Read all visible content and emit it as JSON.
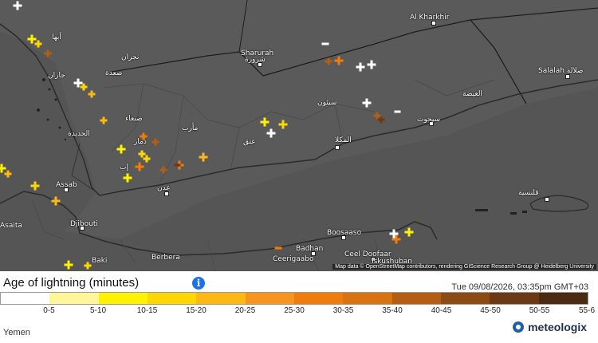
{
  "map": {
    "labels": [
      {
        "id": "al-khakhir",
        "text": "Al Kharkhir",
        "type": "en"
      },
      {
        "id": "sharurah-en",
        "text": "Sharurah",
        "type": "en"
      },
      {
        "id": "sharurah-ar",
        "text": "شرورة",
        "type": "ar"
      },
      {
        "id": "salalah",
        "text": "Salalah صلالة",
        "type": "en"
      },
      {
        "id": "abha",
        "text": "أبها",
        "type": "ar"
      },
      {
        "id": "najran",
        "text": "نجران",
        "type": "ar"
      },
      {
        "id": "jizan",
        "text": "جازان",
        "type": "ar"
      },
      {
        "id": "saada",
        "text": "صعدة",
        "type": "ar"
      },
      {
        "id": "sanaa",
        "text": "صنعاء",
        "type": "ar"
      },
      {
        "id": "marib",
        "text": "مأرب",
        "type": "ar"
      },
      {
        "id": "hudaydah",
        "text": "الحديدة",
        "type": "ar"
      },
      {
        "id": "dhamar",
        "text": "ذمار",
        "type": "ar"
      },
      {
        "id": "ibb",
        "text": "إب",
        "type": "ar"
      },
      {
        "id": "ataq",
        "text": "عتق",
        "type": "ar"
      },
      {
        "id": "aden",
        "text": "عدن",
        "type": "ar"
      },
      {
        "id": "seiyun",
        "text": "سيئون",
        "type": "ar"
      },
      {
        "id": "al-ghaydah",
        "text": "الغيضة",
        "type": "ar"
      },
      {
        "id": "sayhut",
        "text": "سيحوت",
        "type": "ar"
      },
      {
        "id": "mukalla",
        "text": "المكلا",
        "type": "ar"
      },
      {
        "id": "qishn",
        "text": "قلنسية",
        "type": "ar"
      },
      {
        "id": "assab",
        "text": "Assab",
        "type": "en"
      },
      {
        "id": "djibouti",
        "text": "Djibouti",
        "type": "en"
      },
      {
        "id": "asaita",
        "text": "Asaita",
        "type": "en"
      },
      {
        "id": "baki",
        "text": "Baki",
        "type": "en"
      },
      {
        "id": "berbera",
        "text": "Berbera",
        "type": "en"
      },
      {
        "id": "boosaaso",
        "text": "Boosaaso",
        "type": "en"
      },
      {
        "id": "badhan",
        "text": "Badhan",
        "type": "en"
      },
      {
        "id": "ceelgaabo",
        "text": "Ceerigaabo",
        "type": "en"
      },
      {
        "id": "ceel-doofaar",
        "text": "Ceel Doofaar",
        "type": "en"
      },
      {
        "id": "iskushuban",
        "text": "Iskushuban",
        "type": "en"
      }
    ],
    "attribution": "Map data © OpenStreetMap contributors, rendering GIScience Research Group @ Heidelberg University"
  },
  "legend": {
    "title": "Age of lightning (minutes)",
    "info_icon": "info-icon",
    "timestamp": "Tue 09/08/2026, 03:35pm GMT+03",
    "bins": [
      {
        "label": "0-5",
        "color": "#ffffff"
      },
      {
        "label": "5-10",
        "color": "#fff59a"
      },
      {
        "label": "10-15",
        "color": "#fff200"
      },
      {
        "label": "15-20",
        "color": "#ffd700"
      },
      {
        "label": "20-25",
        "color": "#fdb813"
      },
      {
        "label": "25-30",
        "color": "#f7941d"
      },
      {
        "label": "30-35",
        "color": "#ef7d0b"
      },
      {
        "label": "35-40",
        "color": "#d9730f"
      },
      {
        "label": "40-45",
        "color": "#b35e12"
      },
      {
        "label": "45-50",
        "color": "#8c4a14"
      },
      {
        "label": "50-55",
        "color": "#6b3a14"
      },
      {
        "label": "55-6",
        "color": "#4a2a10"
      }
    ]
  },
  "footer": {
    "region": "Yemen",
    "brand": "meteologix"
  }
}
